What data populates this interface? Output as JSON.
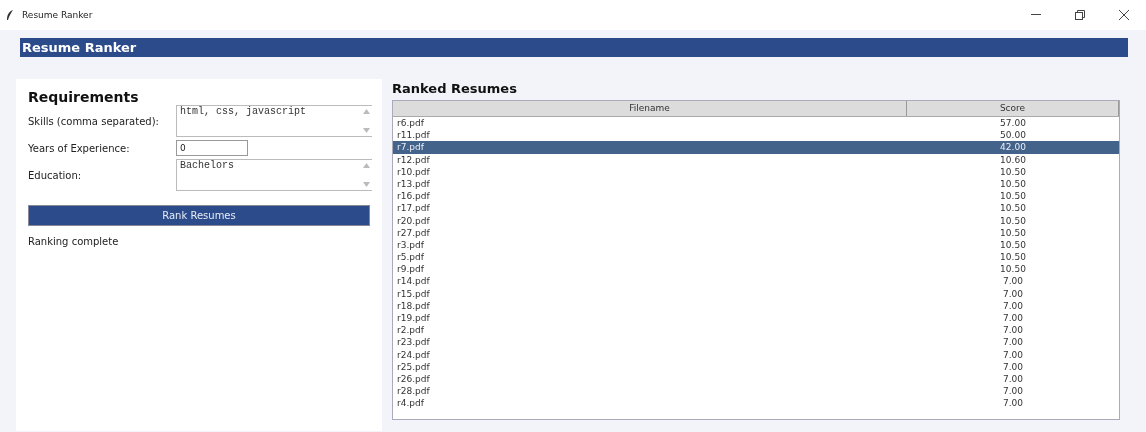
{
  "window": {
    "title": "Resume Ranker"
  },
  "header": {
    "title": "Resume Ranker"
  },
  "requirements": {
    "title": "Requirements",
    "fields": [
      {
        "kind": "textarea",
        "label": "Skills (comma separated):",
        "value": "html, css, javascript"
      },
      {
        "kind": "entry",
        "label": "Years of Experience:",
        "value": "0"
      },
      {
        "kind": "textarea",
        "label": "Education:",
        "value": "Bachelors"
      }
    ],
    "button": "Rank Resumes",
    "status": "Ranking complete"
  },
  "results": {
    "title": "Ranked Resumes",
    "columns": [
      "Filename",
      "Score"
    ],
    "rows": [
      {
        "filename": "r6.pdf",
        "score": "57.00",
        "selected": false
      },
      {
        "filename": "r11.pdf",
        "score": "50.00",
        "selected": false
      },
      {
        "filename": "r7.pdf",
        "score": "42.00",
        "selected": true
      },
      {
        "filename": "r12.pdf",
        "score": "10.60",
        "selected": false
      },
      {
        "filename": "r10.pdf",
        "score": "10.50",
        "selected": false
      },
      {
        "filename": "r13.pdf",
        "score": "10.50",
        "selected": false
      },
      {
        "filename": "r16.pdf",
        "score": "10.50",
        "selected": false
      },
      {
        "filename": "r17.pdf",
        "score": "10.50",
        "selected": false
      },
      {
        "filename": "r20.pdf",
        "score": "10.50",
        "selected": false
      },
      {
        "filename": "r27.pdf",
        "score": "10.50",
        "selected": false
      },
      {
        "filename": "r3.pdf",
        "score": "10.50",
        "selected": false
      },
      {
        "filename": "r5.pdf",
        "score": "10.50",
        "selected": false
      },
      {
        "filename": "r9.pdf",
        "score": "10.50",
        "selected": false
      },
      {
        "filename": "r14.pdf",
        "score": "7.00",
        "selected": false
      },
      {
        "filename": "r15.pdf",
        "score": "7.00",
        "selected": false
      },
      {
        "filename": "r18.pdf",
        "score": "7.00",
        "selected": false
      },
      {
        "filename": "r19.pdf",
        "score": "7.00",
        "selected": false
      },
      {
        "filename": "r2.pdf",
        "score": "7.00",
        "selected": false
      },
      {
        "filename": "r23.pdf",
        "score": "7.00",
        "selected": false
      },
      {
        "filename": "r24.pdf",
        "score": "7.00",
        "selected": false
      },
      {
        "filename": "r25.pdf",
        "score": "7.00",
        "selected": false
      },
      {
        "filename": "r26.pdf",
        "score": "7.00",
        "selected": false
      },
      {
        "filename": "r28.pdf",
        "score": "7.00",
        "selected": false
      },
      {
        "filename": "r4.pdf",
        "score": "7.00",
        "selected": false
      }
    ]
  }
}
